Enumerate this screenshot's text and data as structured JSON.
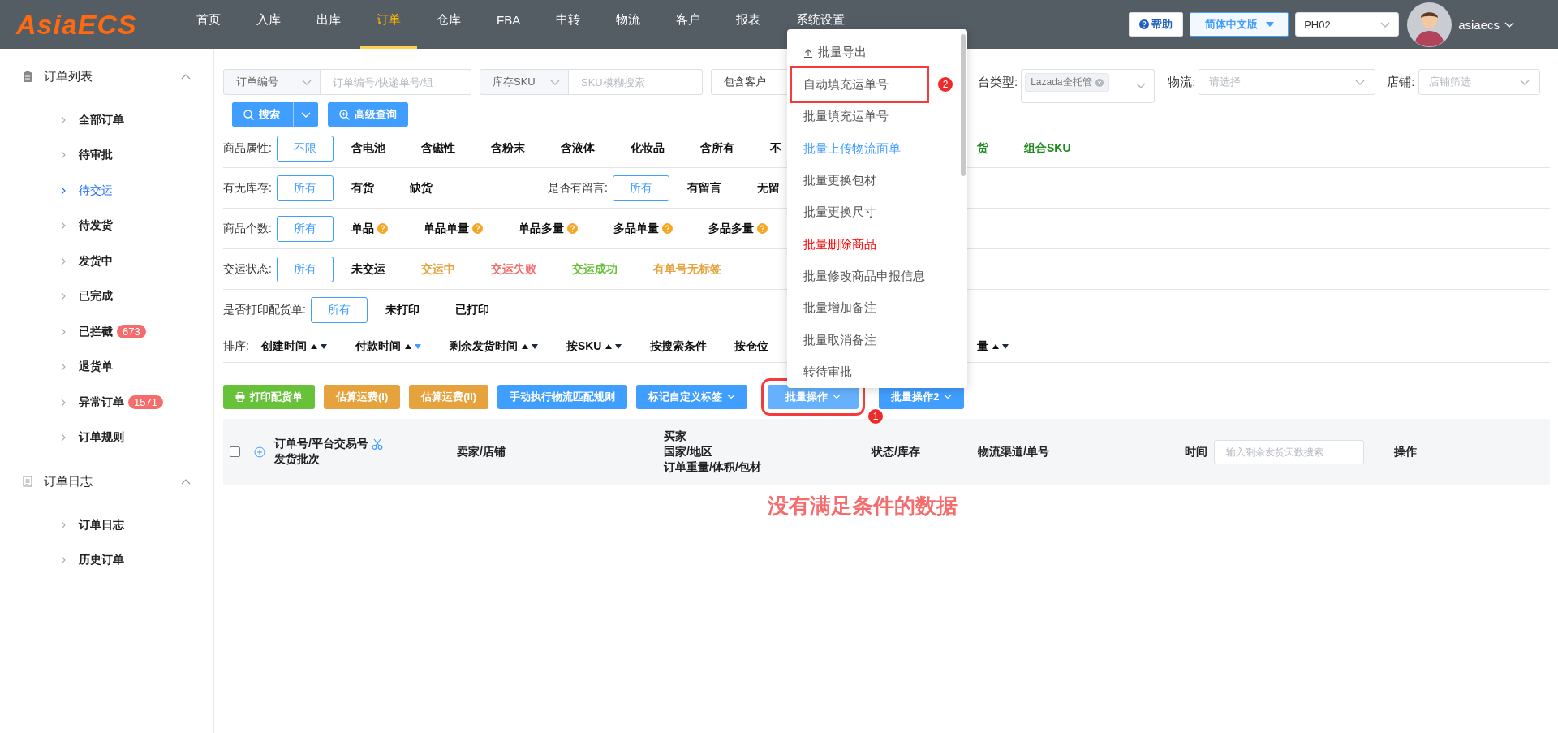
{
  "header": {
    "logo": "AsiaECS",
    "nav": [
      {
        "label": "首页",
        "selected": false
      },
      {
        "label": "入库",
        "selected": false
      },
      {
        "label": "出库",
        "selected": false
      },
      {
        "label": "订单",
        "selected": true
      },
      {
        "label": "仓库",
        "selected": false
      },
      {
        "label": "FBA",
        "selected": false
      },
      {
        "label": "中转",
        "selected": false
      },
      {
        "label": "物流",
        "selected": false
      },
      {
        "label": "客户",
        "selected": false
      },
      {
        "label": "报表",
        "selected": false
      },
      {
        "label": "系统设置",
        "selected": false
      }
    ],
    "help_button": "帮助",
    "language": "简体中文版",
    "warehouse": "PH02",
    "user": "asiaecs"
  },
  "sidebar": {
    "sections": [
      {
        "title": "订单列表",
        "expanded": true,
        "children": [
          {
            "label": "全部订单",
            "selected": false
          },
          {
            "label": "待审批",
            "selected": false
          },
          {
            "label": "待交运",
            "selected": true
          },
          {
            "label": "待发货",
            "selected": false
          },
          {
            "label": "发货中",
            "selected": false
          },
          {
            "label": "已完成",
            "selected": false
          },
          {
            "label": "已拦截",
            "selected": false,
            "badge": "673"
          },
          {
            "label": "退货单",
            "selected": false
          },
          {
            "label": "异常订单",
            "selected": false,
            "badge": "1571"
          },
          {
            "label": "订单规则",
            "selected": false
          }
        ]
      },
      {
        "title": "订单日志",
        "expanded": true,
        "children": [
          {
            "label": "订单日志",
            "selected": false
          },
          {
            "label": "历史订单",
            "selected": false
          }
        ]
      }
    ]
  },
  "search": {
    "fields": [
      {
        "kind": "select-input",
        "select": "订单编号",
        "placeholder": "订单编号/快递单号/组"
      },
      {
        "kind": "select-input",
        "select": "库存SKU",
        "placeholder": "SKU模糊搜索"
      },
      {
        "kind": "select",
        "value": "包含客户"
      }
    ],
    "platform": {
      "label": "台类型:",
      "tags": [
        "Lazada全托管"
      ]
    },
    "logistics": {
      "label": "物流:",
      "placeholder": "请选择"
    },
    "shop": {
      "label": "店铺:",
      "placeholder": "店铺筛选"
    },
    "search_button": "搜索",
    "advanced_button": "高级查询"
  },
  "filters": [
    {
      "groups": [
        {
          "label": "商品属性:",
          "options": [
            {
              "label": "不限",
              "selected": true
            },
            {
              "label": "含电池",
              "selected": false
            },
            {
              "label": "含磁性",
              "selected": false
            },
            {
              "label": "含粉末",
              "selected": false
            },
            {
              "label": "含液体",
              "selected": false
            },
            {
              "label": "化妆品",
              "selected": false
            },
            {
              "label": "含所有",
              "selected": false
            },
            {
              "label": "不",
              "selected": false
            }
          ]
        }
      ],
      "after_menu": [
        {
          "label": "货",
          "selected": false,
          "color": "#1e8a1e"
        },
        {
          "label": "组合SKU",
          "selected": false,
          "color": "#1e8a1e"
        }
      ]
    },
    {
      "groups": [
        {
          "label": "有无库存:",
          "options": [
            {
              "label": "所有",
              "selected": true
            },
            {
              "label": "有货",
              "selected": false
            },
            {
              "label": "缺货",
              "selected": false
            }
          ]
        },
        {
          "label": "是否有留言:",
          "options": [
            {
              "label": "所有",
              "selected": true
            },
            {
              "label": "有留言",
              "selected": false
            },
            {
              "label": "无留",
              "selected": false
            }
          ]
        }
      ]
    },
    {
      "groups": [
        {
          "label": "商品个数:",
          "options": [
            {
              "label": "所有",
              "selected": true
            },
            {
              "label": "单品",
              "selected": false,
              "hint": true
            },
            {
              "label": "单品单量",
              "selected": false,
              "hint": true
            },
            {
              "label": "单品多量",
              "selected": false,
              "hint": true
            },
            {
              "label": "多品单量",
              "selected": false,
              "hint": true
            },
            {
              "label": "多品多量",
              "selected": false,
              "hint": true
            }
          ]
        }
      ]
    },
    {
      "groups": [
        {
          "label": "交运状态:",
          "options": [
            {
              "label": "所有",
              "selected": true
            },
            {
              "label": "未交运",
              "selected": false
            },
            {
              "label": "交运中",
              "selected": false,
              "color": "#e6a23c"
            },
            {
              "label": "交运失败",
              "selected": false,
              "color": "#f56c6c"
            },
            {
              "label": "交运成功",
              "selected": false,
              "color": "#67c23a"
            },
            {
              "label": "有单号无标签",
              "selected": false,
              "color": "#e6a23c"
            }
          ]
        }
      ]
    },
    {
      "groups": [
        {
          "label": "是否打印配货单:",
          "options": [
            {
              "label": "所有",
              "selected": true
            },
            {
              "label": "未打印",
              "selected": false
            },
            {
              "label": "已打印",
              "selected": false
            }
          ]
        }
      ]
    }
  ],
  "sort": {
    "label": "排序:",
    "options": [
      {
        "label": "创建时间",
        "kind": "arrows",
        "up_active": false,
        "down_active": false
      },
      {
        "label": "付款时间",
        "kind": "arrows",
        "up_active": false,
        "down_active": true
      },
      {
        "label": "剩余发货时间",
        "kind": "arrows",
        "up_active": false,
        "down_active": false
      },
      {
        "label": "按SKU",
        "kind": "arrows",
        "up_active": false,
        "down_active": false
      },
      {
        "label": "按搜索条件",
        "kind": "plain"
      },
      {
        "label": "按仓位",
        "kind": "plain"
      }
    ],
    "after_menu": [
      {
        "label": "量",
        "kind": "arrows",
        "up_active": false,
        "down_active": false
      }
    ]
  },
  "toolbar": [
    {
      "label": "打印配货单",
      "kind": "print",
      "color": "#67c23a",
      "dropdown": false,
      "highlighted": false
    },
    {
      "label": "估算运费(I)",
      "kind": "plain",
      "color": "#e6a23c",
      "dropdown": false,
      "highlighted": false
    },
    {
      "label": "估算运费(II)",
      "kind": "plain",
      "color": "#e6a23c",
      "dropdown": false,
      "highlighted": false
    },
    {
      "label": "手动执行物流匹配规则",
      "kind": "plain",
      "color": "#409eff",
      "dropdown": false,
      "highlighted": false
    },
    {
      "label": "标记自定义标签",
      "kind": "plain",
      "color": "#409eff",
      "dropdown": true,
      "highlighted": false
    },
    {
      "label": "批量操作",
      "kind": "plain",
      "color": "#66b1ff",
      "dropdown": true,
      "highlighted": true,
      "marker": "1"
    },
    {
      "label": "批量操作2",
      "kind": "plain",
      "color": "#409eff",
      "dropdown": true,
      "highlighted": false
    }
  ],
  "menu": {
    "items": [
      {
        "label": "批量导出",
        "kind": "export",
        "highlighted": false
      },
      {
        "label": "自动填充运单号",
        "kind": "normal",
        "highlighted": true,
        "marker": "2"
      },
      {
        "label": "批量填充运单号",
        "kind": "normal",
        "highlighted": false
      },
      {
        "label": "批量上传物流面单",
        "kind": "link",
        "highlighted": false
      },
      {
        "label": "批量更换包材",
        "kind": "normal",
        "highlighted": false
      },
      {
        "label": "批量更换尺寸",
        "kind": "normal",
        "highlighted": false
      },
      {
        "label": "批量删除商品",
        "kind": "danger",
        "highlighted": false
      },
      {
        "label": "批量修改商品申报信息",
        "kind": "normal",
        "highlighted": false
      },
      {
        "label": "批量增加备注",
        "kind": "normal",
        "highlighted": false
      },
      {
        "label": "批量取消备注",
        "kind": "normal",
        "highlighted": false
      },
      {
        "label": "转待审批",
        "kind": "normal",
        "highlighted": false
      }
    ]
  },
  "table": {
    "select_all_checked": false,
    "columns": [
      {
        "lines": [
          "订单号/平台交易号",
          "发货批次"
        ],
        "kind": "order"
      },
      {
        "lines": [
          "卖家/店铺"
        ],
        "kind": "plain"
      },
      {
        "lines": [
          "买家",
          "国家/地区",
          "订单重量/体积/包材"
        ],
        "kind": "plain"
      },
      {
        "lines": [
          "状态/库存"
        ],
        "kind": "plain"
      },
      {
        "lines": [
          "物流渠道/单号"
        ],
        "kind": "plain"
      },
      {
        "lines": [
          "时间"
        ],
        "kind": "time",
        "placeholder": "输入剩余发货天数搜索"
      },
      {
        "lines": [
          "操作"
        ],
        "kind": "plain"
      }
    ],
    "empty_text": "没有满足条件的数据"
  }
}
